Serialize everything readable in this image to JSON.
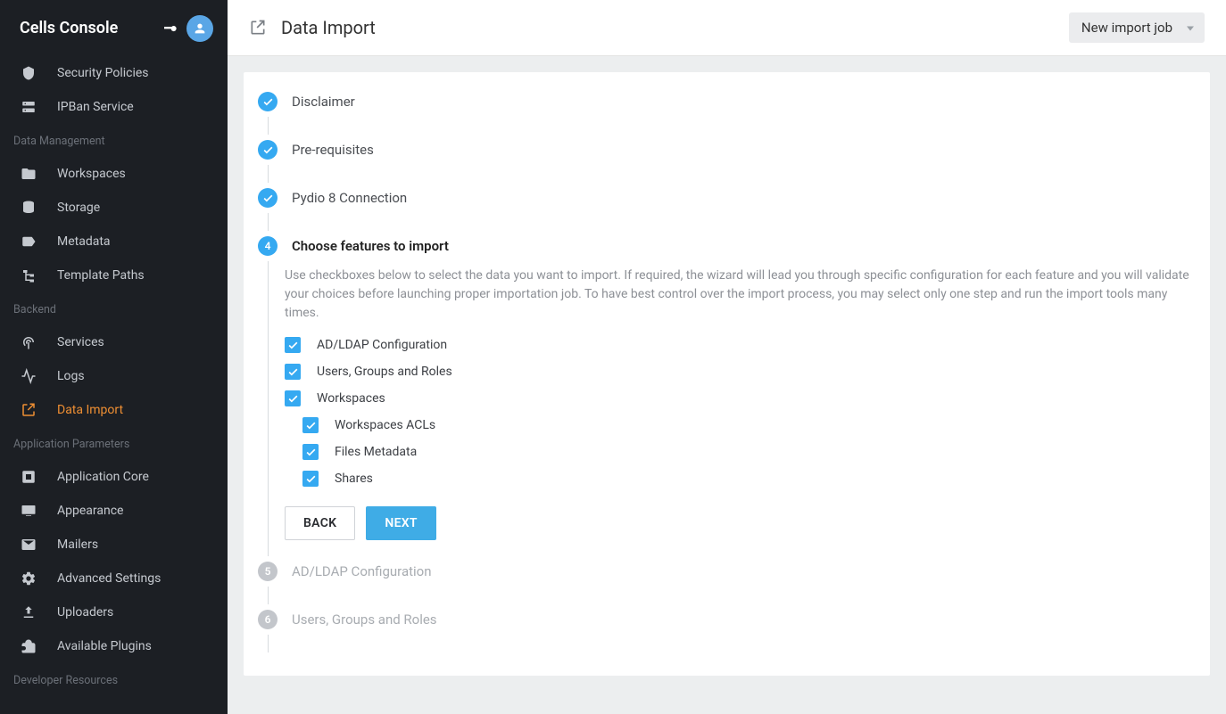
{
  "app": {
    "title": "Cells Console"
  },
  "header": {
    "page_title": "Data Import",
    "dropdown_label": "New import job"
  },
  "sidebar": {
    "top_items": [
      {
        "label": "Security Policies",
        "icon": "shield"
      },
      {
        "label": "IPBan Service",
        "icon": "server"
      }
    ],
    "groups": [
      {
        "label": "Data Management",
        "items": [
          {
            "label": "Workspaces",
            "icon": "folder"
          },
          {
            "label": "Storage",
            "icon": "database"
          },
          {
            "label": "Metadata",
            "icon": "tags"
          },
          {
            "label": "Template Paths",
            "icon": "tree"
          }
        ]
      },
      {
        "label": "Backend",
        "items": [
          {
            "label": "Services",
            "icon": "antenna"
          },
          {
            "label": "Logs",
            "icon": "pulse"
          },
          {
            "label": "Data Import",
            "icon": "import",
            "active": true
          }
        ]
      },
      {
        "label": "Application Parameters",
        "items": [
          {
            "label": "Application Core",
            "icon": "appcore"
          },
          {
            "label": "Appearance",
            "icon": "monitor"
          },
          {
            "label": "Mailers",
            "icon": "mail"
          },
          {
            "label": "Advanced Settings",
            "icon": "gear"
          },
          {
            "label": "Uploaders",
            "icon": "upload"
          },
          {
            "label": "Available Plugins",
            "icon": "plugin"
          }
        ]
      },
      {
        "label": "Developer Resources",
        "items": []
      }
    ]
  },
  "wizard": {
    "steps": [
      {
        "title": "Disclaimer",
        "state": "done"
      },
      {
        "title": "Pre-requisites",
        "state": "done"
      },
      {
        "title": "Pydio 8 Connection",
        "state": "done"
      },
      {
        "title": "Choose features to import",
        "state": "active",
        "number": "4"
      },
      {
        "title": "AD/LDAP Configuration",
        "state": "inactive",
        "number": "5"
      },
      {
        "title": "Users, Groups and Roles",
        "state": "inactive",
        "number": "6"
      }
    ],
    "active_desc": "Use checkboxes below to select the data you want to import. If required, the wizard will lead you through specific configuration for each feature and you will validate your choices before launching proper importation job. To have best control over the import process, you may select only one step and run the import tools many times.",
    "checks": [
      {
        "label": "AD/LDAP Configuration",
        "checked": true,
        "indent": false
      },
      {
        "label": "Users, Groups and Roles",
        "checked": true,
        "indent": false
      },
      {
        "label": "Workspaces",
        "checked": true,
        "indent": false
      },
      {
        "label": "Workspaces ACLs",
        "checked": true,
        "indent": true
      },
      {
        "label": "Files Metadata",
        "checked": true,
        "indent": true
      },
      {
        "label": "Shares",
        "checked": true,
        "indent": true
      }
    ],
    "buttons": {
      "back": "Back",
      "next": "Next"
    }
  }
}
